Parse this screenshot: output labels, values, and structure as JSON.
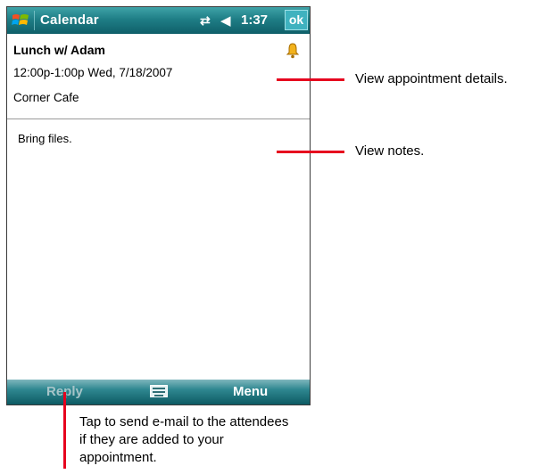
{
  "titlebar": {
    "app_title": "Calendar",
    "clock": "1:37",
    "ok_label": "ok",
    "icons": [
      "windows-start-icon",
      "connectivity-icon",
      "speaker-icon"
    ]
  },
  "appointment": {
    "title": "Lunch w/ Adam",
    "time": "12:00p-1:00p Wed, 7/18/2007",
    "location": "Corner Cafe",
    "reminder_icon": "bell-icon"
  },
  "notes": {
    "text": "Bring files."
  },
  "menubar": {
    "left_label": "Reply",
    "right_label": "Menu",
    "center_icon": "keyboard-icon"
  },
  "callouts": {
    "details": "View appointment details.",
    "notes": "View notes.",
    "reply": "Tap to send e-mail to the attendees if they are added to your appointment."
  },
  "colors": {
    "titlebar": "#1f7e86",
    "callout": "#e6001e",
    "reply_disabled": "#a6c4c8"
  }
}
